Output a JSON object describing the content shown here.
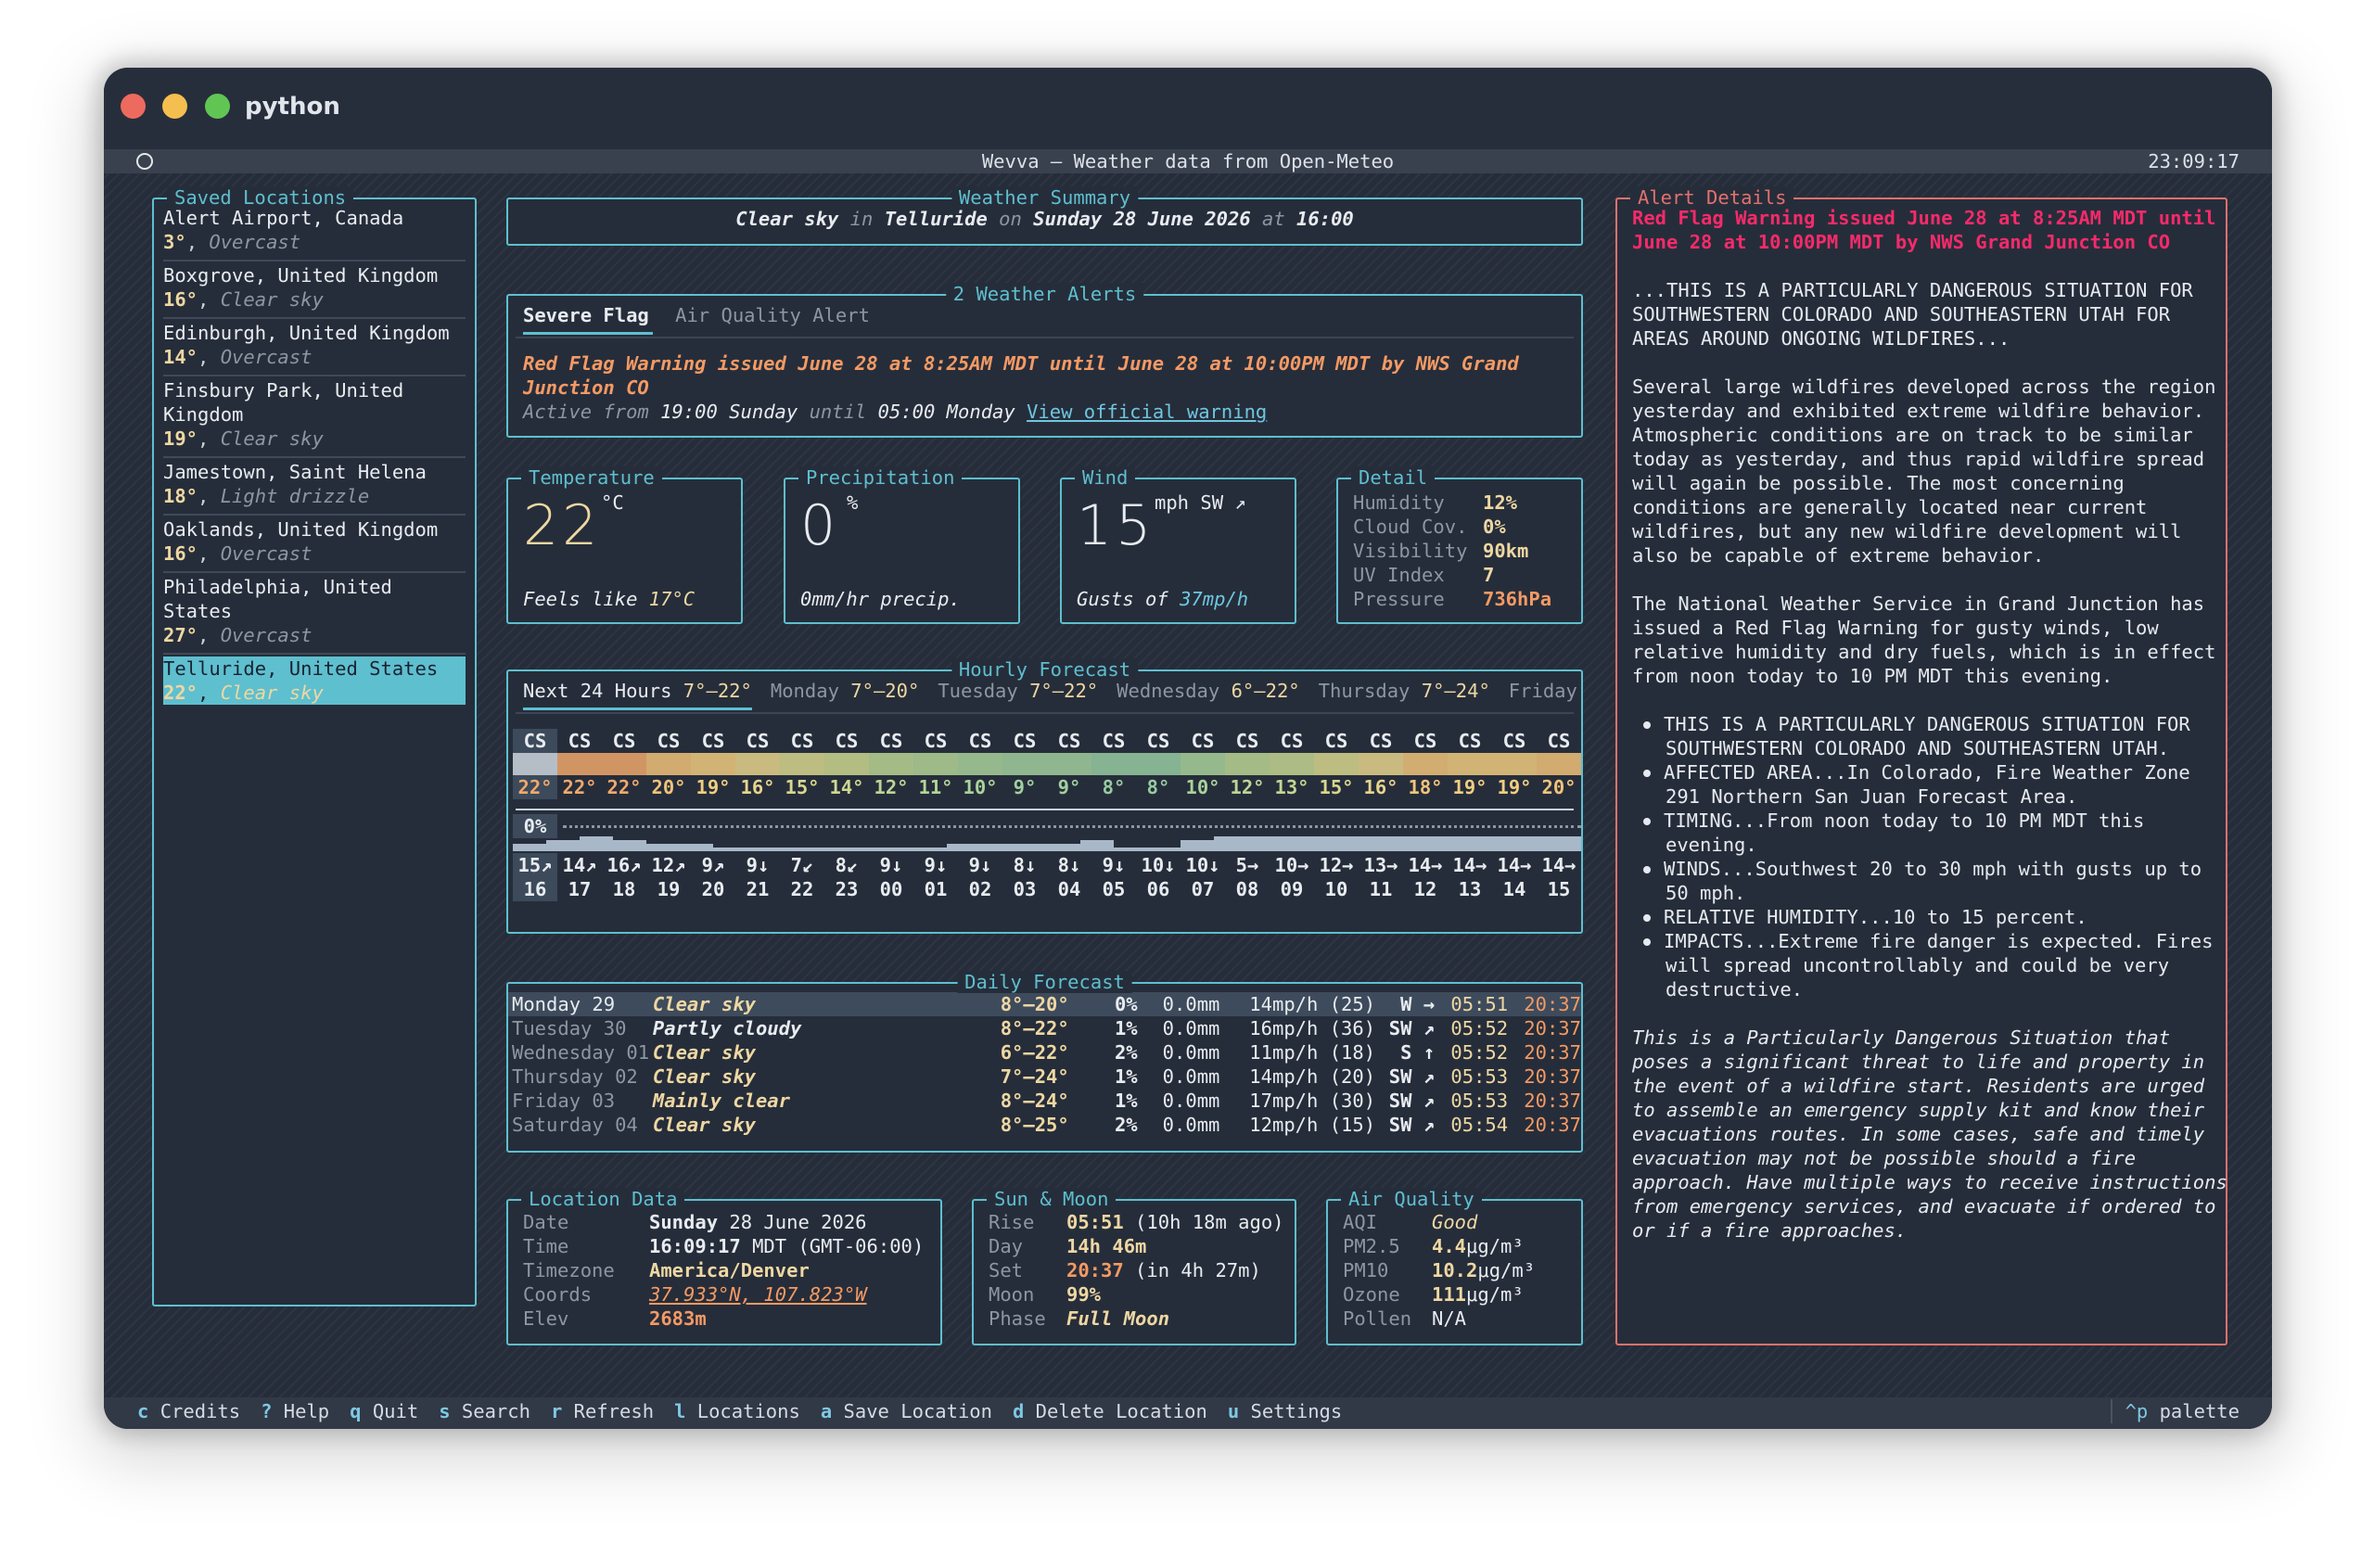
{
  "window": {
    "title": "python"
  },
  "header": {
    "title": "Wevva — Weather data from Open-Meteo",
    "clock": "23:09:17"
  },
  "saved": {
    "label": "Saved Locations",
    "items": [
      {
        "name": "Alert Airport, Canada",
        "temp": "3°",
        "cond": "Overcast"
      },
      {
        "name": "Boxgrove, United Kingdom",
        "temp": "16°",
        "cond": "Clear sky"
      },
      {
        "name": "Edinburgh, United Kingdom",
        "temp": "14°",
        "cond": "Overcast"
      },
      {
        "name": "Finsbury Park, United",
        "name2": "Kingdom",
        "temp": "19°",
        "cond": "Clear sky"
      },
      {
        "name": "Jamestown, Saint Helena",
        "temp": "18°",
        "cond": "Light drizzle"
      },
      {
        "name": "Oaklands, United Kingdom",
        "temp": "16°",
        "cond": "Overcast"
      },
      {
        "name": "Philadelphia, United",
        "name2": "States",
        "temp": "27°",
        "cond": "Overcast"
      },
      {
        "name": "Telluride, United States",
        "temp": "22°",
        "cond": "Clear sky"
      }
    ]
  },
  "summary": {
    "label": "Weather Summary",
    "cond": "Clear sky",
    "in": "in",
    "place": "Telluride",
    "on": "on",
    "date": "Sunday 28 June 2026",
    "at": "at",
    "time": "16:00"
  },
  "alerts": {
    "label": "2 Weather Alerts",
    "tab1": "Severe Flag",
    "tab2": "Air Quality Alert",
    "headline": "Red Flag Warning issued June 28 at 8:25AM MDT until June 28 at 10:00PM MDT by NWS Grand",
    "headline2": "Junction CO",
    "a1": "Active from",
    "from": "19:00 Sunday",
    "a2": "until",
    "to": "05:00 Monday",
    "link": "View official warning"
  },
  "temperature": {
    "label": "Temperature",
    "value": "22",
    "unit": "°C",
    "feels": "Feels like",
    "feels_val": "17°C"
  },
  "precip": {
    "label": "Precipitation",
    "value": "0",
    "unit": "%",
    "text": "0mm/hr precip."
  },
  "wind": {
    "label": "Wind",
    "value": "15",
    "unit": "mph SW ↗",
    "gusts": "Gusts of",
    "gusts_val": "37mp/h"
  },
  "detail": {
    "label": "Detail",
    "rows": [
      {
        "k": "Humidity",
        "v": "12%"
      },
      {
        "k": "Cloud Cov.",
        "v": "0%"
      },
      {
        "k": "Visibility",
        "v": "90km"
      },
      {
        "k": "UV Index",
        "v": "7"
      },
      {
        "k": "Pressure",
        "v": "736hPa"
      }
    ]
  },
  "hourly": {
    "label": "Hourly Forecast",
    "tabs": [
      {
        "d": "Next 24 Hours",
        "r": "7°–22°"
      },
      {
        "d": "Monday",
        "r": "7°–20°"
      },
      {
        "d": "Tuesday",
        "r": "7°–22°"
      },
      {
        "d": "Wednesday",
        "r": "6°–22°"
      },
      {
        "d": "Thursday",
        "r": "7°–24°"
      },
      {
        "d": "Friday",
        "r": ""
      }
    ],
    "codes": [
      "CS",
      "CS",
      "CS",
      "CS",
      "CS",
      "CS",
      "CS",
      "CS",
      "CS",
      "CS",
      "CS",
      "CS",
      "CS",
      "CS",
      "CS",
      "CS",
      "CS",
      "CS",
      "CS",
      "CS",
      "CS",
      "CS",
      "CS",
      "CS"
    ],
    "temps": [
      "22°",
      "22°",
      "22°",
      "20°",
      "19°",
      "16°",
      "15°",
      "14°",
      "12°",
      "11°",
      "10°",
      "9°",
      "9°",
      "8°",
      "8°",
      "10°",
      "12°",
      "13°",
      "15°",
      "16°",
      "18°",
      "19°",
      "19°",
      "20°"
    ],
    "temp_colors": [
      "#f0a86c",
      "#f0a86c",
      "#f0a86c",
      "#f0c27a",
      "#f0cd80",
      "#e6d48c",
      "#d8d68e",
      "#cdd78f",
      "#bcd594",
      "#b3d497",
      "#a9d29b",
      "#a2cf9e",
      "#a2cf9e",
      "#98cba2",
      "#98cba2",
      "#a9d29b",
      "#bcd594",
      "#c4d692",
      "#d8d68e",
      "#e6d48c",
      "#f0c47c",
      "#f0cd80",
      "#f0cd80",
      "#f0c27a"
    ],
    "precip_label": "0%",
    "precip": [
      2,
      3,
      4,
      3,
      2,
      2,
      1,
      1,
      1,
      1,
      1,
      1,
      1,
      2,
      2,
      2,
      2,
      3,
      1,
      1,
      3,
      4,
      4,
      4,
      4,
      4,
      4,
      4,
      4,
      4,
      4,
      4
    ],
    "wind": [
      "15↗",
      "14↗",
      "16↗",
      "12↗",
      "9↗",
      "9↓",
      "7↙",
      "8↙",
      "9↓",
      "9↓",
      "9↓",
      "8↓",
      "8↓",
      "9↓",
      "10↓",
      "10↓",
      "5→",
      "10→",
      "12→",
      "13→",
      "14→",
      "14→",
      "14→",
      "14→"
    ],
    "hours": [
      "16",
      "17",
      "18",
      "19",
      "20",
      "21",
      "22",
      "23",
      "00",
      "01",
      "02",
      "03",
      "04",
      "05",
      "06",
      "07",
      "08",
      "09",
      "10",
      "11",
      "12",
      "13",
      "14",
      "15"
    ]
  },
  "daily": {
    "label": "Daily Forecast",
    "rows": [
      {
        "day": "Monday 29",
        "cond": "Clear sky",
        "range": "8°–20°",
        "pp": "0%",
        "mm": "0.0mm",
        "wind": "14mp/h (25)",
        "dir": "W →",
        "rise": "05:51",
        "set": "20:37"
      },
      {
        "day": "Tuesday 30",
        "cond": "Partly cloudy",
        "range": "8°–22°",
        "pp": "1%",
        "mm": "0.0mm",
        "wind": "16mp/h (36)",
        "dir": "SW ↗",
        "rise": "05:52",
        "set": "20:37"
      },
      {
        "day": "Wednesday 01",
        "cond": "Clear sky",
        "range": "6°–22°",
        "pp": "2%",
        "mm": "0.0mm",
        "wind": "11mp/h (18)",
        "dir": "S ↑",
        "rise": "05:52",
        "set": "20:37"
      },
      {
        "day": "Thursday 02",
        "cond": "Clear sky",
        "range": "7°–24°",
        "pp": "1%",
        "mm": "0.0mm",
        "wind": "14mp/h (20)",
        "dir": "SW ↗",
        "rise": "05:53",
        "set": "20:37"
      },
      {
        "day": "Friday 03",
        "cond": "Mainly clear",
        "range": "8°–24°",
        "pp": "1%",
        "mm": "0.0mm",
        "wind": "17mp/h (30)",
        "dir": "SW ↗",
        "rise": "05:53",
        "set": "20:37"
      },
      {
        "day": "Saturday 04",
        "cond": "Clear sky",
        "range": "8°–25°",
        "pp": "2%",
        "mm": "0.0mm",
        "wind": "12mp/h (15)",
        "dir": "SW ↗",
        "rise": "05:54",
        "set": "20:37"
      }
    ]
  },
  "location": {
    "label": "Location Data",
    "rows": [
      {
        "k": "Date",
        "v": "Sunday",
        "v2": " 28 June 2026"
      },
      {
        "k": "Time",
        "v": "16:09:17",
        "v2": " MDT (GMT-06:00)"
      },
      {
        "k": "Timezone",
        "v": "America/Denver",
        "v2": ""
      },
      {
        "k": "Coords",
        "v": "37.933°N, 107.823°W",
        "v2": ""
      },
      {
        "k": "Elev",
        "v": "2683m",
        "v2": ""
      }
    ]
  },
  "sun": {
    "label": "Sun & Moon",
    "rows": [
      {
        "k": "Rise",
        "v": "05:51",
        "v2": " (10h 18m ago)"
      },
      {
        "k": "Day",
        "v": "14h 46m",
        "v2": ""
      },
      {
        "k": "Set",
        "v": "20:37",
        "v2": " (in 4h 27m)"
      },
      {
        "k": "Moon",
        "v": "99%",
        "v2": ""
      },
      {
        "k": "Phase",
        "v": "Full Moon",
        "v2": ""
      }
    ]
  },
  "air": {
    "label": "Air Quality",
    "rows": [
      {
        "k": "AQI",
        "v": "Good",
        "u": ""
      },
      {
        "k": "PM2.5",
        "v": "4.4",
        "u": "μg/m³"
      },
      {
        "k": "PM10",
        "v": "10.2",
        "u": "μg/m³"
      },
      {
        "k": "Ozone",
        "v": "111",
        "u": "μg/m³"
      },
      {
        "k": "Pollen",
        "v": "N/A",
        "u": ""
      }
    ]
  },
  "alert_detail": {
    "label": "Alert Details",
    "head": [
      "Red Flag Warning issued June 28 at 8:25AM MDT until",
      "June 28 at 10:00PM MDT by NWS Grand Junction CO"
    ],
    "p1": [
      "...THIS IS A PARTICULARLY DANGEROUS SITUATION FOR",
      "SOUTHWESTERN COLORADO AND SOUTHEASTERN UTAH FOR",
      "AREAS AROUND ONGOING WILDFIRES..."
    ],
    "p2": [
      "Several large wildfires developed across the region",
      "yesterday and exhibited extreme wildfire behavior.",
      "Atmospheric conditions are on track to be similar",
      "today as yesterday, and thus rapid wildfire spread",
      "will again be possible. The most concerning",
      "conditions are generally located near current",
      "wildfires, but any new wildfire development will",
      "also be capable of extreme behavior."
    ],
    "p3": [
      "The National Weather Service in Grand Junction has",
      "issued a Red Flag Warning for gusty winds, low",
      "relative humidity and dry fuels, which is in effect",
      "from noon today to 10 PM MDT this evening."
    ],
    "bullets": [
      [
        "THIS IS A PARTICULARLY DANGEROUS SITUATION FOR",
        "SOUTHWESTERN COLORADO AND SOUTHEASTERN UTAH."
      ],
      [
        "AFFECTED AREA...In Colorado, Fire Weather Zone",
        "291 Northern San Juan Forecast Area."
      ],
      [
        "TIMING...From noon today to 10 PM MDT this",
        "evening."
      ],
      [
        "WINDS...Southwest 20 to 30 mph with gusts up to",
        "50 mph."
      ],
      [
        "RELATIVE HUMIDITY...10 to 15 percent."
      ],
      [
        "IMPACTS...Extreme fire danger is expected. Fires",
        "will spread uncontrollably and could be very",
        "destructive."
      ]
    ],
    "p4": [
      "This is a Particularly Dangerous Situation that",
      "poses a significant threat to life and property in",
      "the event of a wildfire start. Residents are urged",
      "to assemble an emergency supply kit and know their",
      "evacuations routes. In some cases, safe and timely",
      "evacuation may not be possible should a fire",
      "approach. Have multiple ways to receive instructions",
      "from emergency services, and evacuate if ordered to",
      "or if a fire approaches."
    ]
  },
  "footer": {
    "items": [
      {
        "k": "c",
        "l": "Credits"
      },
      {
        "k": "?",
        "l": "Help"
      },
      {
        "k": "q",
        "l": "Quit"
      },
      {
        "k": "s",
        "l": "Search"
      },
      {
        "k": "r",
        "l": "Refresh"
      },
      {
        "k": "l",
        "l": "Locations"
      },
      {
        "k": "a",
        "l": "Save Location"
      },
      {
        "k": "d",
        "l": "Delete Location"
      },
      {
        "k": "u",
        "l": "Settings"
      }
    ],
    "palette_key": "^p",
    "palette": "palette"
  }
}
